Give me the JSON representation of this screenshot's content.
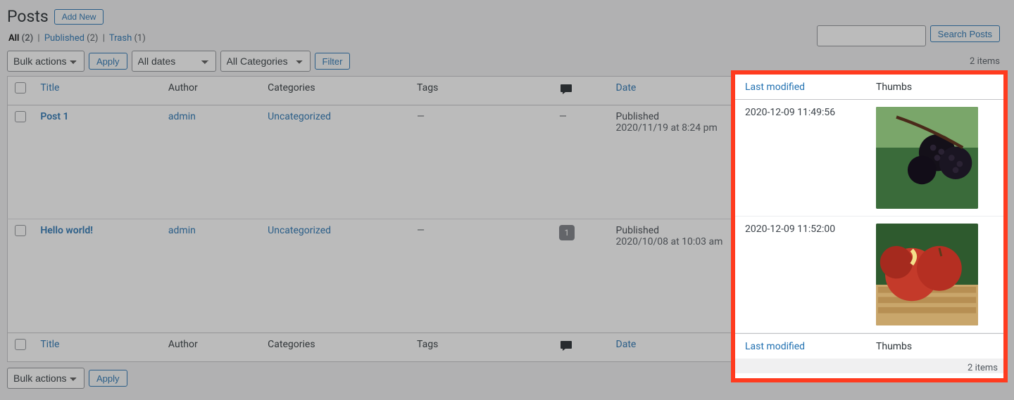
{
  "header": {
    "title": "Posts",
    "add_new": "Add New"
  },
  "search": {
    "button": "Search Posts",
    "placeholder": ""
  },
  "views": {
    "all_label": "All",
    "all_count": "(2)",
    "published_label": "Published",
    "published_count": "(2)",
    "trash_label": "Trash",
    "trash_count": "(1)",
    "sep": "|"
  },
  "filters": {
    "bulk": "Bulk actions",
    "apply": "Apply",
    "dates": "All dates",
    "categories": "All Categories",
    "filter": "Filter"
  },
  "items_count": "2 items",
  "columns": {
    "title": "Title",
    "author": "Author",
    "categories": "Categories",
    "tags": "Tags",
    "date": "Date",
    "last_modified": "Last modified",
    "thumbs": "Thumbs"
  },
  "rows": [
    {
      "title": "Post 1",
      "author": "admin",
      "category": "Uncategorized",
      "tags": "—",
      "comments": "—",
      "status": "Published",
      "date": "2020/11/19 at 8:24 pm",
      "last_modified": "2020-12-09 11:49:56",
      "thumb": "blackberries"
    },
    {
      "title": "Hello world!",
      "author": "admin",
      "category": "Uncategorized",
      "tags": "—",
      "comments": "1",
      "status": "Published",
      "date": "2020/10/08 at 10:03 am",
      "last_modified": "2020-12-09 11:52:00",
      "thumb": "apples"
    }
  ]
}
